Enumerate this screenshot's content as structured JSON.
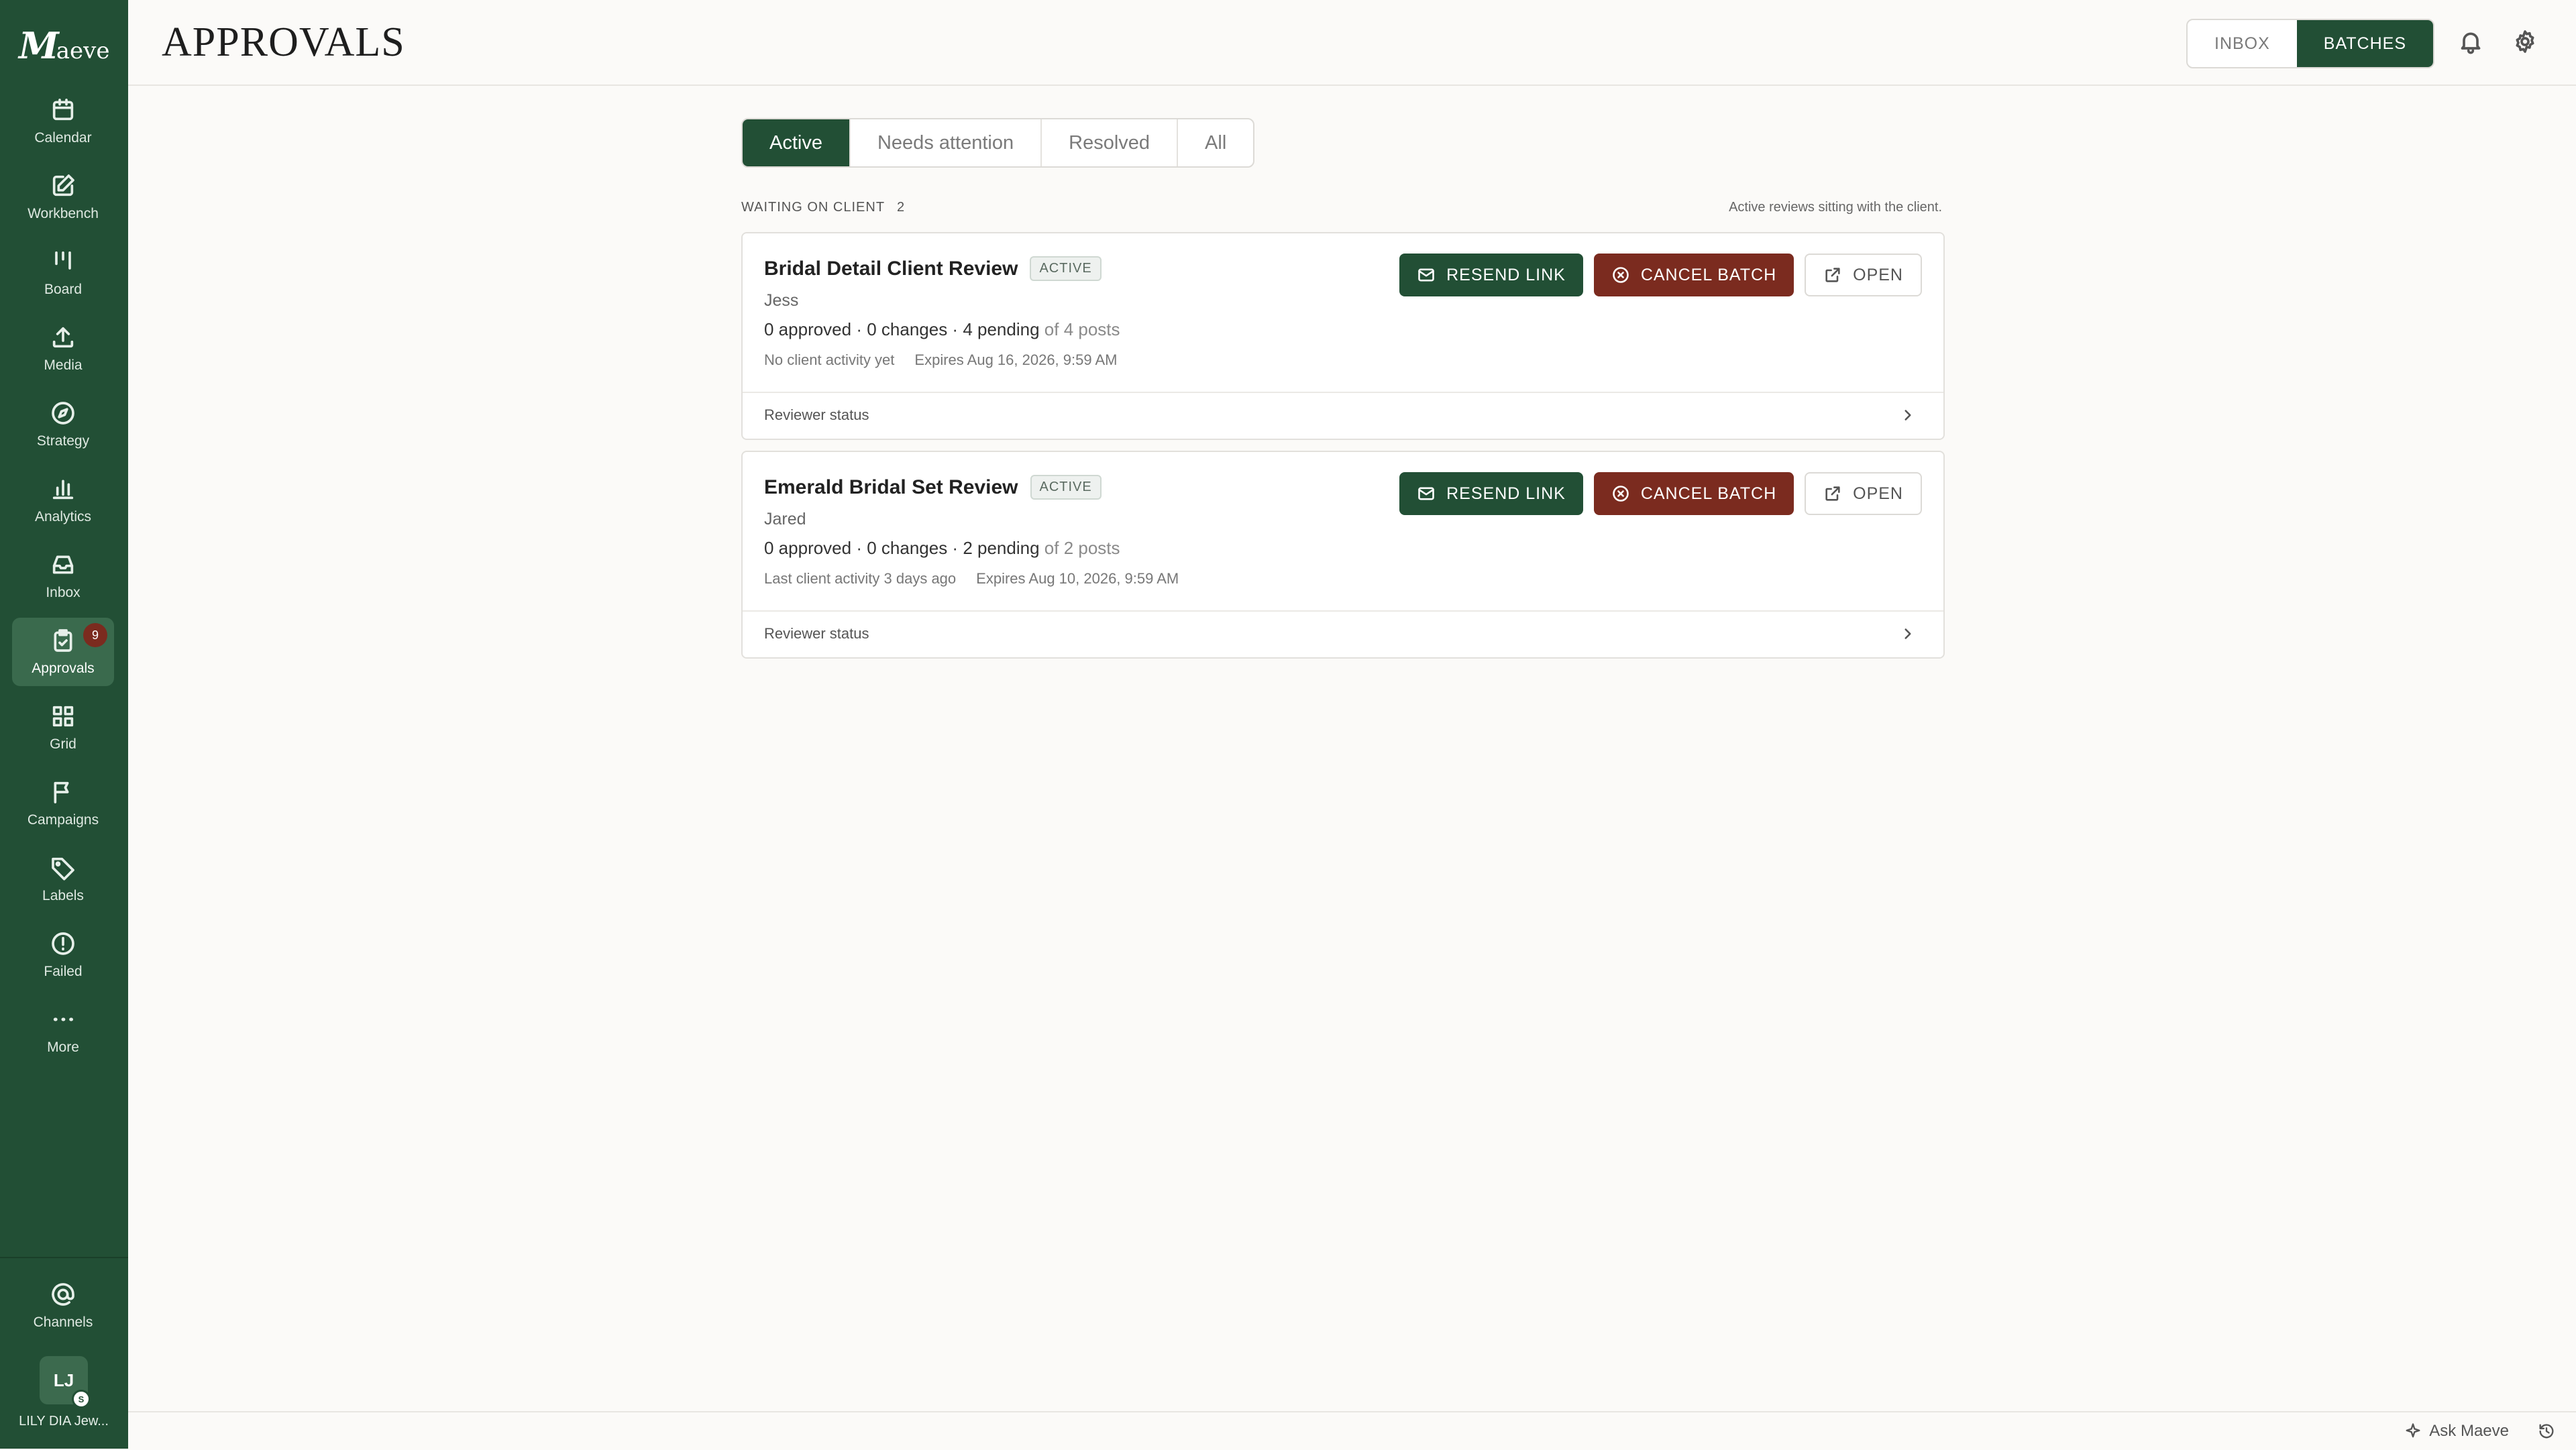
{
  "app": {
    "logo_mark": "M",
    "logo_rest": "aeve",
    "page_title": "APPROVALS"
  },
  "sidebar": {
    "items": [
      {
        "label": "Calendar",
        "icon": "calendar-icon"
      },
      {
        "label": "Workbench",
        "icon": "edit-icon"
      },
      {
        "label": "Board",
        "icon": "board-icon"
      },
      {
        "label": "Media",
        "icon": "upload-icon"
      },
      {
        "label": "Strategy",
        "icon": "compass-icon"
      },
      {
        "label": "Analytics",
        "icon": "bar-chart-icon"
      },
      {
        "label": "Inbox",
        "icon": "inbox-icon"
      },
      {
        "label": "Approvals",
        "icon": "clipboard-check-icon",
        "badge": "9",
        "active": true
      },
      {
        "label": "Grid",
        "icon": "grid-icon"
      },
      {
        "label": "Campaigns",
        "icon": "flag-icon"
      },
      {
        "label": "Labels",
        "icon": "tag-icon"
      },
      {
        "label": "Failed",
        "icon": "alert-circle-icon"
      },
      {
        "label": "More",
        "icon": "more-dots-icon"
      }
    ],
    "channels_label": "Channels",
    "avatar_initials": "LJ",
    "avatar_dot": "S",
    "account_name": "LILY DIA Jew..."
  },
  "topbar": {
    "view_options": [
      "INBOX",
      "BATCHES"
    ],
    "selected_view": "BATCHES"
  },
  "tabs": {
    "items": [
      "Active",
      "Needs attention",
      "Resolved",
      "All"
    ],
    "selected": "Active"
  },
  "section": {
    "label": "WAITING ON CLIENT",
    "count": "2",
    "hint": "Active reviews sitting with the client."
  },
  "batches": [
    {
      "title": "Bridal Detail Client Review",
      "status": "ACTIVE",
      "client": "Jess",
      "approved": "0 approved",
      "changes": "0 changes",
      "pending": "4 pending",
      "of_posts": "of 4 posts",
      "activity": "No client activity yet",
      "expires": "Expires Aug 16, 2026, 9:59 AM",
      "resend": "RESEND LINK",
      "cancel": "CANCEL BATCH",
      "open": "OPEN",
      "reviewer_status": "Reviewer status"
    },
    {
      "title": "Emerald Bridal Set Review",
      "status": "ACTIVE",
      "client": "Jared",
      "approved": "0 approved",
      "changes": "0 changes",
      "pending": "2 pending",
      "of_posts": "of 2 posts",
      "activity": "Last client activity 3 days ago",
      "expires": "Expires Aug 10, 2026, 9:59 AM",
      "resend": "RESEND LINK",
      "cancel": "CANCEL BATCH",
      "open": "OPEN",
      "reviewer_status": "Reviewer status"
    }
  ],
  "footer": {
    "ask_label": "Ask Maeve"
  },
  "colors": {
    "brand_green": "#224f35",
    "danger_red": "#7b2b1f",
    "background": "#fbfaf8"
  }
}
